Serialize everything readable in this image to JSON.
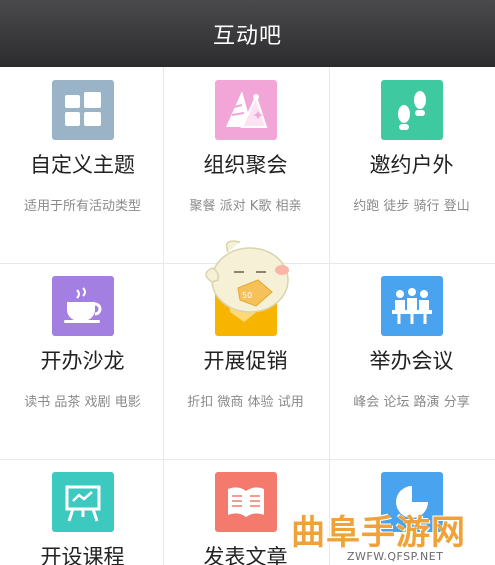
{
  "header": {
    "title": "互动吧"
  },
  "categories": [
    {
      "name": "自定义主题",
      "desc": "适用于所有活动类型",
      "icon": "grid-icon",
      "color": "#9ab3c6"
    },
    {
      "name": "组织聚会",
      "desc": "聚餐 派对 K歌 相亲",
      "icon": "party-hats-icon",
      "color": "#f2a6d8"
    },
    {
      "name": "邀约户外",
      "desc": "约跑 徒步 骑行 登山",
      "icon": "footprints-icon",
      "color": "#3fc9a0"
    },
    {
      "name": "开办沙龙",
      "desc": "读书 品茶 戏剧 电影",
      "icon": "coffee-cup-icon",
      "color": "#a27fe0"
    },
    {
      "name": "开展促销",
      "desc": "折扣 微商 体验 试用",
      "icon": "price-tag-icon",
      "color": "#f7b400"
    },
    {
      "name": "举办会议",
      "desc": "峰会 论坛 路演 分享",
      "icon": "meeting-icon",
      "color": "#4aa3ee"
    },
    {
      "name": "开设课程",
      "desc": "",
      "icon": "easel-icon",
      "color": "#3cc9c0"
    },
    {
      "name": "发表文章",
      "desc": "",
      "icon": "book-icon",
      "color": "#f47a6e"
    },
    {
      "name": "",
      "desc": "",
      "icon": "circle-icon",
      "color": "#4aa3ee"
    }
  ],
  "watermark": {
    "main": "曲阜手游网",
    "sub": "ZWFW.QFSP.NET"
  }
}
